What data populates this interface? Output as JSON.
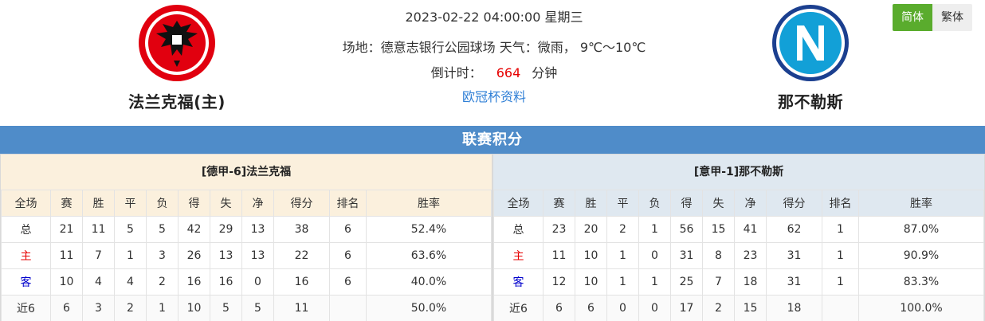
{
  "header": {
    "datetime": "2023-02-22 04:00:00 星期三",
    "venue_line": "场地：德意志银行公园球场 天气：微雨， 9℃～10℃",
    "countdown_label": "倒计时：",
    "countdown_value": "664",
    "countdown_unit": "分钟",
    "link": "欧冠杯资料"
  },
  "home_team": {
    "name": "法兰克福(主)",
    "logo_icon": "eintracht-eagle-crest-icon",
    "color": "#e1000f"
  },
  "away_team": {
    "name": "那不勒斯",
    "logo_icon": "napoli-n-crest-icon",
    "color": "#12a0d7"
  },
  "lang": {
    "simplified": "简体",
    "traditional": "繁体"
  },
  "section_title": "联赛积分",
  "columns": [
    "全场",
    "赛",
    "胜",
    "平",
    "负",
    "得",
    "失",
    "净",
    "得分",
    "排名",
    "胜率"
  ],
  "home_panel": {
    "title": "[德甲-6]法兰克福",
    "rows": [
      [
        "总",
        "21",
        "11",
        "5",
        "5",
        "42",
        "29",
        "13",
        "38",
        "6",
        "52.4%"
      ],
      [
        "主",
        "11",
        "7",
        "1",
        "3",
        "26",
        "13",
        "13",
        "22",
        "6",
        "63.6%"
      ],
      [
        "客",
        "10",
        "4",
        "4",
        "2",
        "16",
        "16",
        "0",
        "16",
        "6",
        "40.0%"
      ],
      [
        "近6",
        "6",
        "3",
        "2",
        "1",
        "10",
        "5",
        "5",
        "11",
        "",
        "50.0%"
      ]
    ]
  },
  "away_panel": {
    "title": "[意甲-1]那不勒斯",
    "rows": [
      [
        "总",
        "23",
        "20",
        "2",
        "1",
        "56",
        "15",
        "41",
        "62",
        "1",
        "87.0%"
      ],
      [
        "主",
        "11",
        "10",
        "1",
        "0",
        "31",
        "8",
        "23",
        "31",
        "1",
        "90.9%"
      ],
      [
        "客",
        "12",
        "10",
        "1",
        "1",
        "25",
        "7",
        "18",
        "31",
        "1",
        "83.3%"
      ],
      [
        "近6",
        "6",
        "6",
        "0",
        "0",
        "17",
        "2",
        "15",
        "18",
        "",
        "100.0%"
      ]
    ]
  },
  "colors": {
    "accent_blue": "#4f8cc9",
    "home_header_bg": "#fbf0dd",
    "away_header_bg": "#dfe8f0",
    "active_lang": "#5aac2d",
    "countdown_red": "#e60000",
    "link_blue": "#2f7fd6"
  }
}
